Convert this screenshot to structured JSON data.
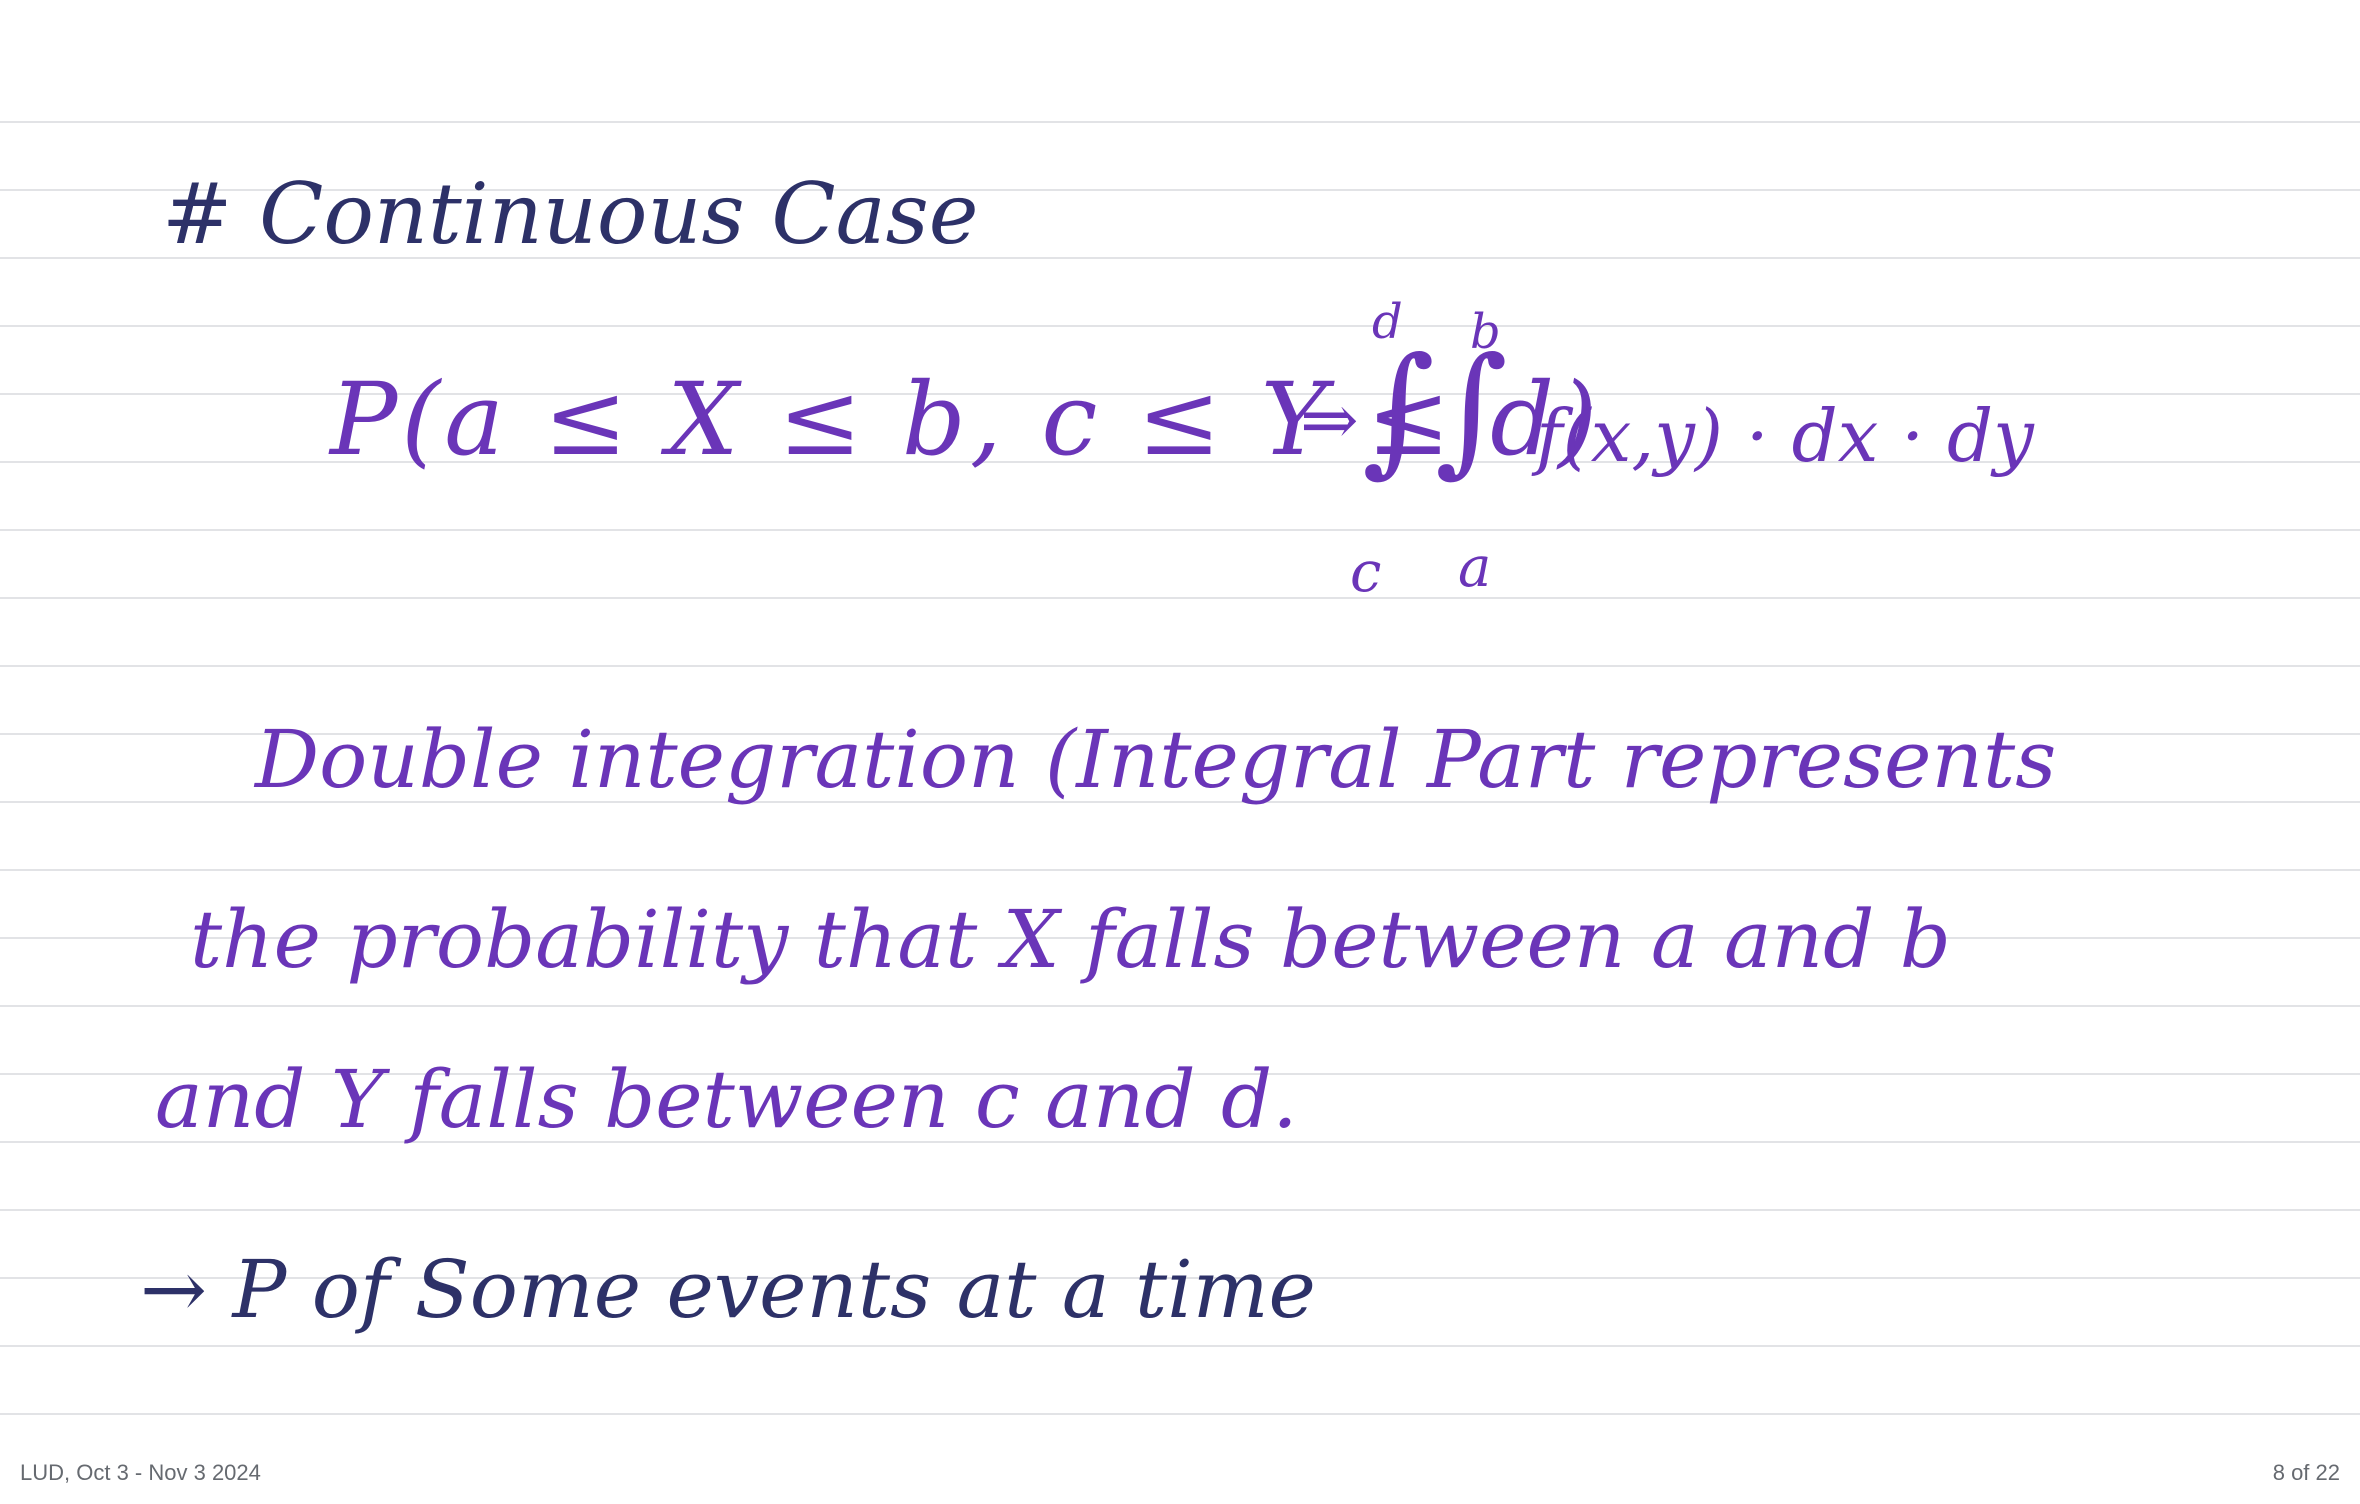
{
  "note": {
    "heading": "# Continuous Case",
    "formula": {
      "lhs": "P(a ≤ X ≤ b, c ≤ Y ≤ d)",
      "arrow": "⇒",
      "integral_signs": "∫∫",
      "outer_upper": "d",
      "outer_lower": "c",
      "inner_upper": "b",
      "inner_lower": "a",
      "integrand": "f(x,y) · dx · dy"
    },
    "paragraph_lines": [
      "Double integration (Integral Part represents",
      "the probability that X falls between a and b",
      "and Y falls between c and d."
    ],
    "bullet": "→ P of Some events at a time"
  },
  "footer": {
    "left": "LUD, Oct 3 - Nov 3 2024",
    "right": "8 of 22"
  },
  "colors": {
    "ink_purple": "#6a35b8",
    "ink_navy": "#2d3168",
    "rule_line": "#e2e3e6"
  }
}
